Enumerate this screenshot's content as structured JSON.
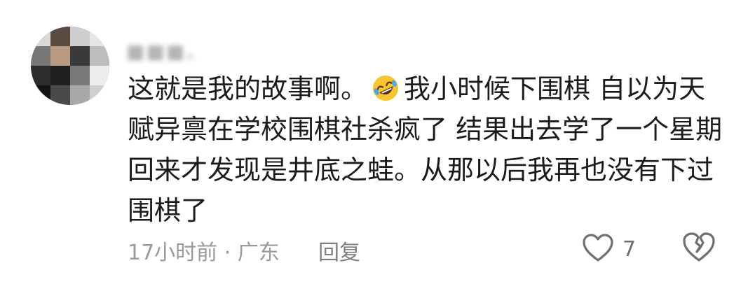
{
  "comment": {
    "username": "■■■。",
    "body_line_1_part_a": "这就是我的故事啊。",
    "body_line_1_part_b": "我小时候下围棋 自以为天赋异禀在学校围棋社杀疯了 结果出去学了一个星期回来才发现是井底之蛙。从那以后我再也没有下过围棋了",
    "emoji": "rolling-on-floor-laughing-emoji",
    "time_location": "17小时前 · 广东",
    "reply_label": "回复",
    "like_count": "7"
  },
  "colors": {
    "text": "#1b1b1b",
    "meta": "#9a9a9a",
    "icon": "#6f6f6f"
  }
}
